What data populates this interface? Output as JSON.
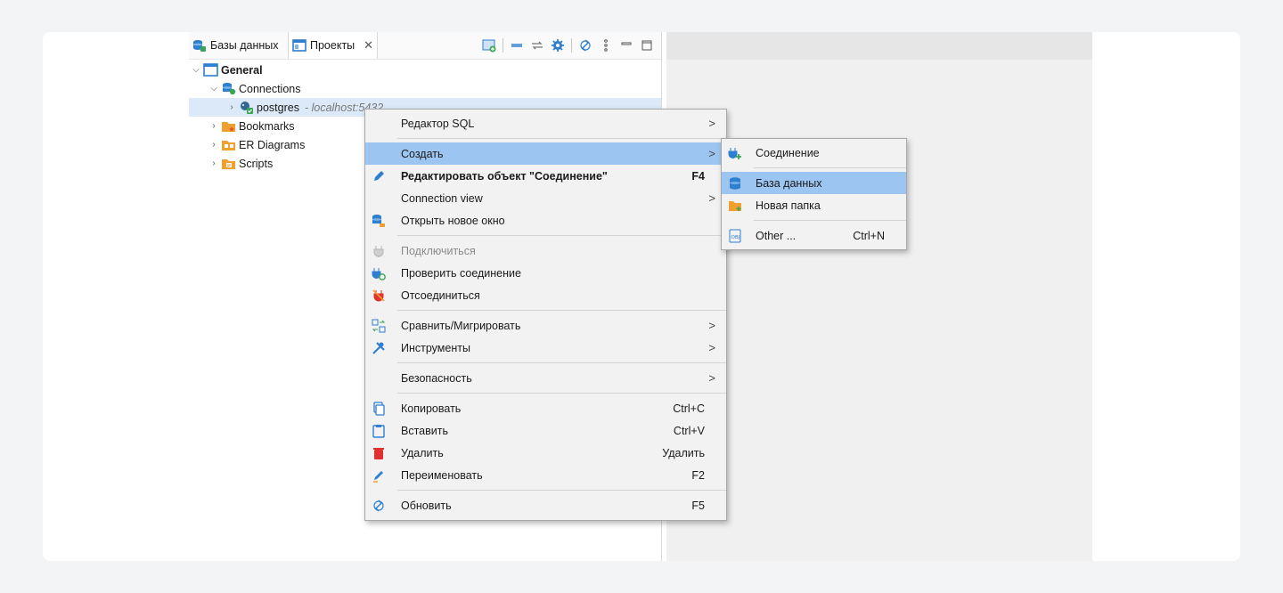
{
  "tabs": {
    "databases": "Базы данных",
    "projects": "Проекты"
  },
  "tree": {
    "general": "General",
    "connections": "Connections",
    "postgres": "postgres",
    "postgres_host": "- localhost:5432",
    "bookmarks": "Bookmarks",
    "er_diagrams": "ER Diagrams",
    "scripts": "Scripts"
  },
  "context_menu": {
    "sql_editor": "Редактор SQL",
    "create": "Создать",
    "edit_object": "Редактировать объект \"Соединение\"",
    "edit_object_shortcut": "F4",
    "connection_view": "Connection view",
    "open_new_window": "Открыть новое окно",
    "connect": "Подключиться",
    "check_connection": "Проверить соединение",
    "disconnect": "Отсоединиться",
    "compare_migrate": "Сравнить/Мигрировать",
    "tools": "Инструменты",
    "security": "Безопасность",
    "copy": "Копировать",
    "copy_shortcut": "Ctrl+C",
    "paste": "Вставить",
    "paste_shortcut": "Ctrl+V",
    "delete": "Удалить",
    "delete_shortcut": "Удалить",
    "rename": "Переименовать",
    "rename_shortcut": "F2",
    "refresh": "Обновить",
    "refresh_shortcut": "F5",
    "submenu_arrow": ">"
  },
  "create_submenu": {
    "connection": "Соединение",
    "database": "База данных",
    "new_folder": "Новая папка",
    "other": "Other ...",
    "other_shortcut": "Ctrl+N"
  },
  "colors": {
    "highlight": "#9cc6f1",
    "selected_row": "#dbe9f8",
    "menu_bg": "#f2f2f2",
    "folder_orange": "#f0a030",
    "db_blue": "#2f7fd1"
  }
}
